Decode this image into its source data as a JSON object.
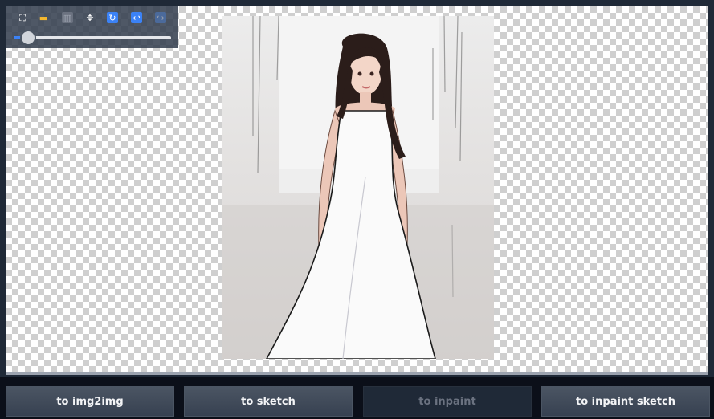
{
  "toolbar": {
    "icons": [
      {
        "name": "fullscreen-icon",
        "glyph": "⛶",
        "color": "#ffffff",
        "bg": "transparent"
      },
      {
        "name": "folder-icon",
        "glyph": "▬",
        "color": "#f5b82e",
        "bg": "transparent"
      },
      {
        "name": "trash-icon",
        "glyph": "▥",
        "color": "#9ca3af",
        "bg": "#6b7280"
      },
      {
        "name": "move-icon",
        "glyph": "✥",
        "color": "#ffffff",
        "bg": "transparent"
      },
      {
        "name": "reset-icon",
        "glyph": "↻",
        "color": "#ffffff",
        "bg": "#3b82f6"
      },
      {
        "name": "undo-icon",
        "glyph": "↩",
        "color": "#ffffff",
        "bg": "#3b82f6"
      },
      {
        "name": "redo-icon",
        "glyph": "↪",
        "color": "#9ca3af",
        "bg": "#4b6a9b"
      }
    ],
    "brush_size": 0.08
  },
  "actions": {
    "to_img2img": "to img2img",
    "to_sketch": "to sketch",
    "to_inpaint": "to inpaint",
    "to_inpaint_sketch": "to inpaint sketch"
  },
  "colors": {
    "accent": "#3b82f6",
    "button": "#4b5563",
    "background": "#0b0f19"
  }
}
